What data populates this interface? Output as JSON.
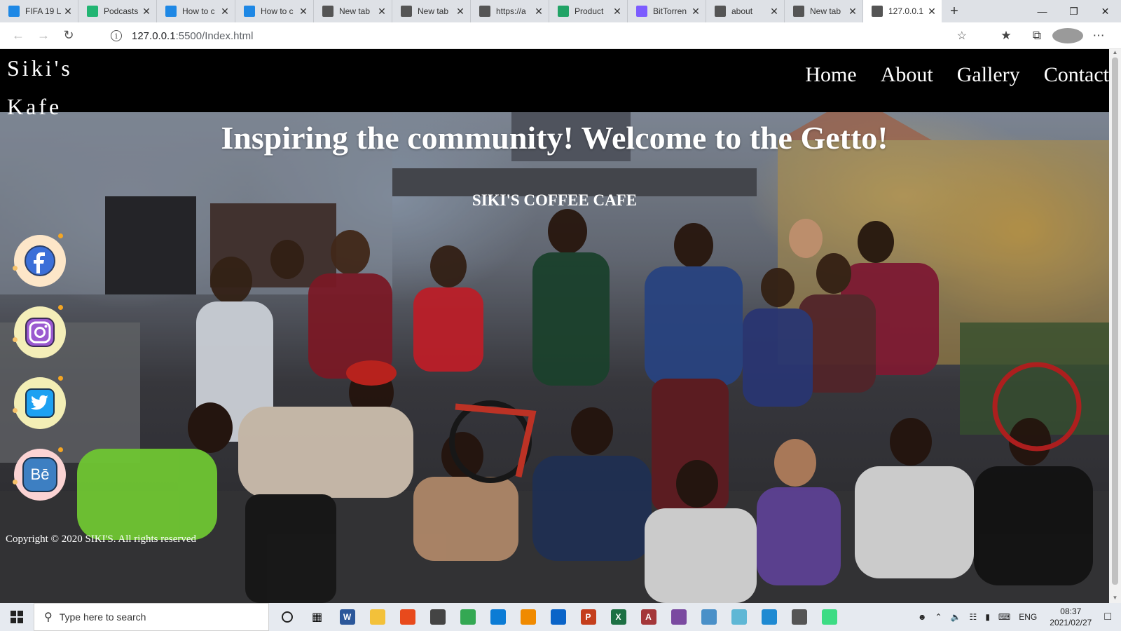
{
  "browser": {
    "tabs": [
      {
        "title": "FIFA 19 L",
        "icon": "edge-page-icon",
        "color": "#1e88e5"
      },
      {
        "title": "Podcasts",
        "icon": "podcasts-icon",
        "color": "#22b573"
      },
      {
        "title": "How to c",
        "icon": "edge-page-icon",
        "color": "#1e88e5"
      },
      {
        "title": "How to c",
        "icon": "edge-page-icon",
        "color": "#1e88e5"
      },
      {
        "title": "New tab",
        "icon": "new-tab-icon",
        "color": "#555555"
      },
      {
        "title": "New tab",
        "icon": "new-tab-icon",
        "color": "#555555"
      },
      {
        "title": "https://a",
        "icon": "page-icon",
        "color": "#555555"
      },
      {
        "title": "Product",
        "icon": "wordpress-icon",
        "color": "#21a366"
      },
      {
        "title": "BitTorren",
        "icon": "bittorrent-icon",
        "color": "#7c5cff"
      },
      {
        "title": "about",
        "icon": "page-icon",
        "color": "#555555"
      },
      {
        "title": "New tab",
        "icon": "new-tab-icon",
        "color": "#555555"
      },
      {
        "title": "127.0.0.1",
        "icon": "page-icon",
        "color": "#555555",
        "active": true
      }
    ],
    "url_host": "127.0.0.1",
    "url_path": ":5500/Index.html"
  },
  "site": {
    "logo_line1": "Siki's",
    "logo_line2": "Kafe",
    "menu": [
      "Home",
      "About",
      "Gallery",
      "Contact"
    ],
    "hero_title": "Inspiring the community! Welcome to the Getto!",
    "hero_subtitle": "SIKI'S COFFEE CAFE",
    "social": [
      {
        "name": "facebook",
        "bg": "#fde6c8",
        "inner": "#3b6fd8"
      },
      {
        "name": "instagram",
        "bg": "#f4eeb8",
        "inner": "#8e5bd0"
      },
      {
        "name": "twitter",
        "bg": "#f3eeb5",
        "inner": "#1da1f2"
      },
      {
        "name": "behance",
        "bg": "#fbd3d3",
        "inner": "#3d7fc2"
      }
    ],
    "behance_label": "Bē",
    "copyright": "Copyright © 2020 SIKI'S. All rights reserved"
  },
  "taskbar": {
    "search_placeholder": "Type here to search",
    "apps": [
      {
        "name": "word",
        "color": "#2b579a",
        "label": "W"
      },
      {
        "name": "file-explorer",
        "color": "#f3c13a",
        "label": ""
      },
      {
        "name": "office",
        "color": "#e84a1c",
        "label": ""
      },
      {
        "name": "store",
        "color": "#444444",
        "label": ""
      },
      {
        "name": "chrome",
        "color": "#34a853",
        "label": ""
      },
      {
        "name": "edge",
        "color": "#0c7cd5",
        "label": ""
      },
      {
        "name": "vlc",
        "color": "#f08a00",
        "label": ""
      },
      {
        "name": "mail",
        "color": "#0a64c8",
        "label": ""
      },
      {
        "name": "powerpoint",
        "color": "#c43e1c",
        "label": "P"
      },
      {
        "name": "excel",
        "color": "#1d7044",
        "label": "X"
      },
      {
        "name": "access",
        "color": "#a4373a",
        "label": "A"
      },
      {
        "name": "winrar",
        "color": "#7a4aa0",
        "label": ""
      },
      {
        "name": "control-panel",
        "color": "#4a90c8",
        "label": ""
      },
      {
        "name": "paint",
        "color": "#5fb7d5",
        "label": ""
      },
      {
        "name": "vscode",
        "color": "#1f8ad2",
        "label": ""
      },
      {
        "name": "settings",
        "color": "#555555",
        "label": ""
      },
      {
        "name": "android-studio",
        "color": "#3ddc84",
        "label": ""
      }
    ],
    "language": "ENG",
    "time": "08:37",
    "date": "2021/02/27"
  }
}
